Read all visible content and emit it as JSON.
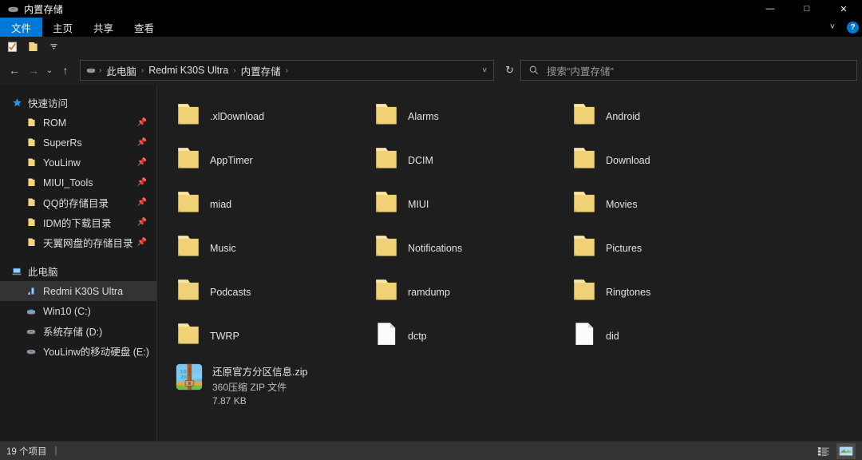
{
  "window": {
    "title": "内置存储",
    "title_icon": "drive-icon",
    "controls": {
      "minimize": "—",
      "maximize": "□",
      "close": "✕"
    }
  },
  "ribbon": {
    "tabs": [
      {
        "label": "文件",
        "active": true
      },
      {
        "label": "主页",
        "active": false
      },
      {
        "label": "共享",
        "active": false
      },
      {
        "label": "查看",
        "active": false
      }
    ],
    "expand_icon": "chevron-down-icon",
    "help_label": "?"
  },
  "quick_access_toolbar": {
    "items": [
      {
        "name": "properties-icon"
      },
      {
        "name": "new-folder-icon"
      },
      {
        "name": "customize-dropdown-icon"
      }
    ]
  },
  "navbar": {
    "back": "←",
    "forward": "→",
    "recent": "⌄",
    "up": "↑",
    "breadcrumbs": [
      "此电脑",
      "Redmi K30S Ultra",
      "内置存储"
    ],
    "separator": "›",
    "history_chevron": "⌄",
    "refresh": "↻"
  },
  "search": {
    "placeholder": "搜索\"内置存储\"",
    "icon": "search-icon",
    "value": ""
  },
  "sidebar": {
    "groups": [
      {
        "label": "快速访问",
        "icon": "star-icon",
        "items": [
          {
            "label": "ROM",
            "icon": "folder-icon",
            "pinned": true,
            "selected": false
          },
          {
            "label": "SuperRs",
            "icon": "folder-icon",
            "pinned": true,
            "selected": false
          },
          {
            "label": "YouLinw",
            "icon": "folder-icon",
            "pinned": true,
            "selected": false
          },
          {
            "label": "MIUI_Tools",
            "icon": "folder-icon",
            "pinned": true,
            "selected": false
          },
          {
            "label": "QQ的存储目录",
            "icon": "folder-icon",
            "pinned": true,
            "selected": false
          },
          {
            "label": "IDM的下载目录",
            "icon": "folder-icon",
            "pinned": true,
            "selected": false
          },
          {
            "label": "天翼网盘的存储目录",
            "icon": "folder-icon",
            "pinned": true,
            "selected": false
          }
        ]
      },
      {
        "label": "此电脑",
        "icon": "computer-icon",
        "items": [
          {
            "label": "Redmi K30S Ultra",
            "icon": "phone-icon",
            "pinned": false,
            "selected": true
          },
          {
            "label": "Win10 (C:)",
            "icon": "windows-drive-icon",
            "pinned": false,
            "selected": false
          },
          {
            "label": "系统存储 (D:)",
            "icon": "drive-icon",
            "pinned": false,
            "selected": false
          },
          {
            "label": "YouLinw的移动硬盘 (E:)",
            "icon": "drive-icon",
            "pinned": false,
            "selected": false
          }
        ]
      }
    ],
    "pin_icon": "pin-icon"
  },
  "files": {
    "items": [
      {
        "name": ".xlDownload",
        "type": "folder"
      },
      {
        "name": "Alarms",
        "type": "folder"
      },
      {
        "name": "Android",
        "type": "folder"
      },
      {
        "name": "AppTimer",
        "type": "folder"
      },
      {
        "name": "DCIM",
        "type": "folder"
      },
      {
        "name": "Download",
        "type": "folder"
      },
      {
        "name": "miad",
        "type": "folder"
      },
      {
        "name": "MIUI",
        "type": "folder"
      },
      {
        "name": "Movies",
        "type": "folder"
      },
      {
        "name": "Music",
        "type": "folder"
      },
      {
        "name": "Notifications",
        "type": "folder"
      },
      {
        "name": "Pictures",
        "type": "folder"
      },
      {
        "name": "Podcasts",
        "type": "folder"
      },
      {
        "name": "ramdump",
        "type": "folder"
      },
      {
        "name": "Ringtones",
        "type": "folder"
      },
      {
        "name": "TWRP",
        "type": "folder"
      },
      {
        "name": "dctp",
        "type": "file"
      },
      {
        "name": "did",
        "type": "file"
      }
    ],
    "detail_item": {
      "name": "还原官方分区信息.zip",
      "type_label": "360压缩 ZIP 文件",
      "size": "7.87 KB",
      "icon": "zip-archive-icon"
    }
  },
  "statusbar": {
    "item_count": "19 个项目",
    "separator": "|",
    "views": [
      {
        "name": "details-view-button",
        "active": false
      },
      {
        "name": "large-icons-view-button",
        "active": true
      }
    ]
  },
  "colors": {
    "accent": "#0078d7",
    "folder": "#f5d57a",
    "window_bg": "#1e1e1e",
    "sidebar_bg": "#1b1b1b",
    "statusbar_bg": "#333333",
    "text": "#e2e2e2"
  }
}
